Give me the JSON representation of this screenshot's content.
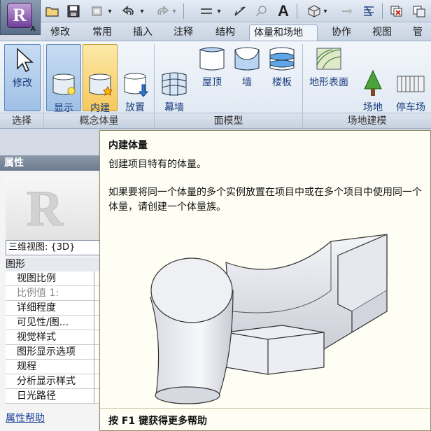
{
  "app": {
    "logo_letter": "R",
    "logo_sub": "A"
  },
  "qat_icons": [
    "open-icon",
    "save-icon",
    "sync-icon",
    "undo-icon",
    "redo-icon",
    "measure-icon",
    "dimension-icon",
    "tag-icon",
    "text-icon",
    "3d-view-icon",
    "section-icon",
    "thin-lines-icon",
    "close-hidden-icon",
    "switch-windows-icon"
  ],
  "tabs": [
    {
      "label": "修改"
    },
    {
      "label": "常用"
    },
    {
      "label": "插入"
    },
    {
      "label": "注释"
    },
    {
      "label": "结构"
    },
    {
      "label": "体量和场地"
    },
    {
      "label": "协作"
    },
    {
      "label": "视图"
    },
    {
      "label": "管理"
    }
  ],
  "ribbon": {
    "modify": "修改",
    "show_mass": "显示\n体量",
    "inplace_mass": "内建\n体量",
    "place_mass": "放置\n体量",
    "curtain_system": "幕墙\n系统",
    "roof": "屋顶",
    "wall": "墙",
    "floor": "楼板",
    "toposurface": "地形表面",
    "site_component": "场地\n构件",
    "parking_component": "停车场\n构件",
    "groups": {
      "select": "选择",
      "conceptual_mass": "概念体量",
      "face_model": "面模型",
      "site_modeling": "场地建模"
    }
  },
  "properties": {
    "title": "属性",
    "type_selector": "三维视图: {3D}",
    "category": "图形",
    "rows": [
      {
        "label": "视图比例",
        "dim": false
      },
      {
        "label": "比例值 1:",
        "dim": true
      },
      {
        "label": "详细程度",
        "dim": false
      },
      {
        "label": "可见性/图...",
        "dim": false
      },
      {
        "label": "视觉样式",
        "dim": false
      },
      {
        "label": "图形显示选项",
        "dim": false
      },
      {
        "label": "规程",
        "dim": false
      },
      {
        "label": "分析显示样式",
        "dim": false
      },
      {
        "label": "日光路径",
        "dim": false
      }
    ],
    "help_link": "属性帮助"
  },
  "tooltip": {
    "title": "内建体量",
    "description": "创建项目特有的体量。",
    "long_text": "如果要将同一个体量的多个实例放置在项目中或在多个项目中使用同一个体量，请创建一个体量族。",
    "footer": "按 F1 键获得更多帮助"
  }
}
